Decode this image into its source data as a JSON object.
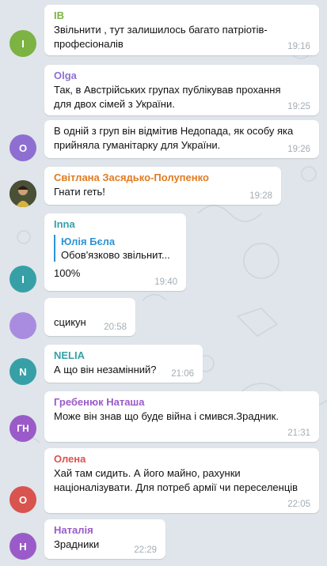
{
  "colors": {
    "background": "#dfe5ea",
    "ib": "#7cb342",
    "olga": "#8e6fd1",
    "svitlana": "#e07b22",
    "inna": "#37a0a6",
    "nelia": "#37a0a6",
    "hrebeniuk": "#9a5bc9",
    "olena": "#d9534f",
    "natalia": "#9a5bc9",
    "reply_accent": "#2e93d6"
  },
  "messages": [
    {
      "sender": "IB",
      "avatar_letter": "I",
      "text": "Звільнити , тут залишилось багато патріотів-\nпрофесіоналів",
      "time": "19:16"
    },
    {
      "sender": "Olga",
      "text": "Так, в Австрійських групах публікував прохання\nдля двох сімей з України.",
      "time": "19:25"
    },
    {
      "avatar_letter": "O",
      "text": "В одній з груп він відмітив Недопада, як особу яка\nприйняла гуманітарку для України.",
      "time": "19:26"
    },
    {
      "sender": "Світлана Засядько-Полупенко",
      "text": "Гнати геть!",
      "time": "19:28"
    },
    {
      "sender": "Inna",
      "avatar_letter": "I",
      "reply_name": "Юлія Бєла",
      "reply_text": "Обов'язково звільнит...",
      "text": "100%",
      "time": "19:40"
    },
    {
      "text": "сцикун",
      "time": "20:58"
    },
    {
      "sender": "NELIA",
      "avatar_letter": "N",
      "text": "А що він незамінний?",
      "time": "21:06"
    },
    {
      "sender": "Гребенюк Наташа",
      "avatar_letter": "ГН",
      "text": "Може він знав що буде війна і смився.Зрадник.",
      "time": "21:31"
    },
    {
      "sender": "Олена",
      "avatar_letter": "O",
      "text": "Хай там сидить. А його майно, рахунки\nнаціоналізувати. Для потреб армії чи переселенців",
      "time": "22:05"
    },
    {
      "sender": "Наталія",
      "avatar_letter": "Н",
      "text": "Зрадники",
      "time": "22:29"
    }
  ]
}
